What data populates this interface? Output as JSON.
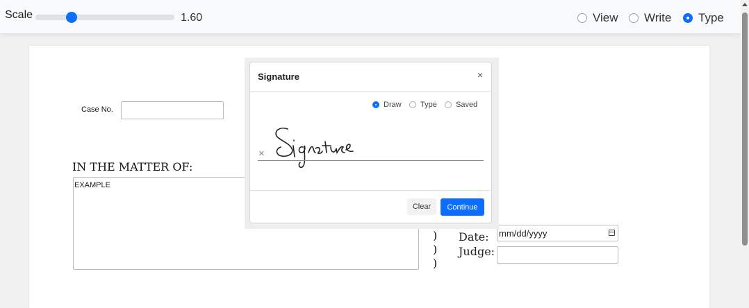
{
  "toolbar": {
    "scale_label": "Scale",
    "scale_value": "1.60",
    "modes": [
      {
        "label": "View",
        "selected": false
      },
      {
        "label": "Write",
        "selected": false
      },
      {
        "label": "Type",
        "selected": true
      }
    ]
  },
  "form": {
    "case_label": "Case No.",
    "case_value": "",
    "matter_heading": "IN THE MATTER OF:",
    "matter_text": "EXAMPLE",
    "parens": [
      ")",
      ")",
      ")"
    ],
    "date_label": "Date:",
    "date_placeholder": "mm/dd/yyyy",
    "judge_label": "Judge:",
    "judge_value": ""
  },
  "signature_modal": {
    "title": "Signature",
    "close_symbol": "×",
    "modes": [
      {
        "label": "Draw",
        "selected": true
      },
      {
        "label": "Type",
        "selected": false
      },
      {
        "label": "Saved",
        "selected": false
      }
    ],
    "clear_mark": "×",
    "clear_label": "Clear",
    "continue_label": "Continue"
  },
  "colors": {
    "accent": "#0d6efd"
  }
}
